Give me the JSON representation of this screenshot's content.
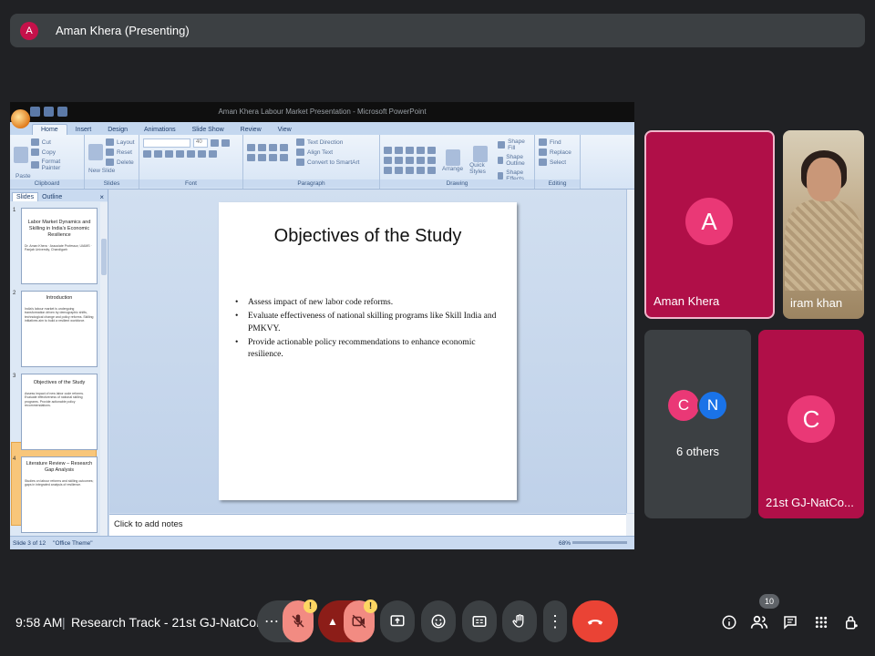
{
  "presenter": {
    "avatar_letter": "A",
    "label": "Aman Khera (Presenting)",
    "avatar_color": "#c5114a"
  },
  "powerpoint": {
    "window_title": "Aman Khera Labour Market Presentation - Microsoft PowerPoint",
    "tabs": [
      "Home",
      "Insert",
      "Design",
      "Animations",
      "Slide Show",
      "Review",
      "View"
    ],
    "active_tab": "Home",
    "ribbon_groups": [
      {
        "label": "Clipboard",
        "items": [
          "Cut",
          "Copy",
          "Format Painter",
          "Paste"
        ]
      },
      {
        "label": "Slides",
        "items": [
          "Layout",
          "Reset",
          "Delete",
          "New Slide"
        ]
      },
      {
        "label": "Font",
        "items": [
          "40"
        ]
      },
      {
        "label": "Paragraph",
        "items": [
          "Text Direction",
          "Align Text",
          "Convert to SmartArt"
        ]
      },
      {
        "label": "Drawing",
        "items": [
          "Arrange",
          "Quick Styles",
          "Shape Fill",
          "Shape Outline",
          "Shape Effects"
        ]
      },
      {
        "label": "Editing",
        "items": [
          "Find",
          "Replace",
          "Select"
        ]
      }
    ],
    "panel_tabs": [
      "Slides",
      "Outline"
    ],
    "thumbnails": [
      {
        "num": "1",
        "title": "Labor Market Dynamics and Skilling in India's Economic Resilience",
        "body": "Dr. Aman Khera · Associate Professor, UIAMS · Panjab University, Chandigarh"
      },
      {
        "num": "2",
        "title": "Introduction",
        "body": "India's labour market is undergoing transformation driven by demographic shifts, technological change and policy reforms. Skilling initiatives aim to build a resilient workforce."
      },
      {
        "num": "3",
        "title": "Objectives of the Study",
        "body": "Assess impact of new labor code reforms. Evaluate effectiveness of national skilling programs. Provide actionable policy recommendations."
      },
      {
        "num": "4",
        "title": "Literature Review – Research Gap Analysis",
        "body": "Studies on labour reforms and skilling outcomes; gaps in integrated analysis of resilience."
      }
    ],
    "slide": {
      "title": "Objectives of the Study",
      "bullets": [
        "Assess impact of new labor code reforms.",
        "Evaluate effectiveness of national skilling programs like Skill India and PMKVY.",
        "Provide actionable policy recommendations to enhance economic resilience."
      ]
    },
    "notes_placeholder": "Click to add notes",
    "status": {
      "slide_counter": "Slide 3 of 12",
      "theme": "\"Office Theme\"",
      "zoom": "68%"
    }
  },
  "participants": {
    "aman": {
      "letter": "A",
      "name": "Aman Khera"
    },
    "iram": {
      "name": "iram khan"
    },
    "others": {
      "letters": [
        "C",
        "N"
      ],
      "label": "6 others",
      "colors": [
        "#ea3876",
        "#1a73e8"
      ]
    },
    "gj": {
      "letter": "C",
      "name": "21st GJ-NatCo..."
    }
  },
  "bottom_bar": {
    "time": "9:58 AM",
    "separator": "|",
    "meeting_title": "Research Track - 21st GJ-NatCon...",
    "warning_symbol": "!",
    "people_count": "10",
    "controls": [
      "more-options",
      "microphone",
      "mic-options",
      "camera",
      "present",
      "emoji",
      "captions",
      "raise-hand",
      "more",
      "leave-call"
    ],
    "right_controls": [
      "info",
      "people",
      "chat",
      "activities",
      "host-controls"
    ],
    "colors": {
      "leave": "#ea4335",
      "muted": "#f28b82",
      "muted_dark": "#8c1d18"
    }
  }
}
